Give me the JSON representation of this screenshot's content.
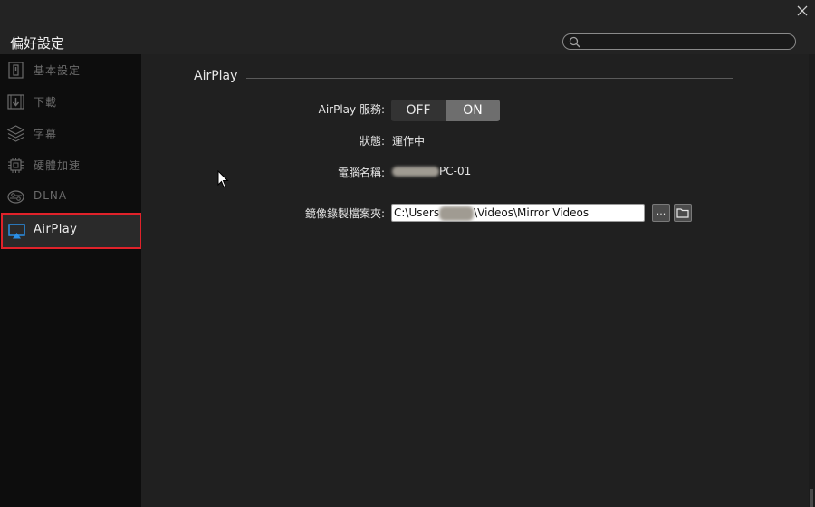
{
  "window": {
    "title": "偏好設定",
    "search_placeholder": ""
  },
  "sidebar": {
    "items": [
      {
        "label": "基本設定",
        "icon": "settings-panel-icon"
      },
      {
        "label": "下載",
        "icon": "download-icon"
      },
      {
        "label": "字幕",
        "icon": "layers-icon"
      },
      {
        "label": "硬體加速",
        "icon": "chip-icon"
      },
      {
        "label": "DLNA",
        "icon": "dlna-icon"
      },
      {
        "label": "AirPlay",
        "icon": "airplay-icon",
        "active": true
      }
    ]
  },
  "main": {
    "section_title": "AirPlay",
    "service": {
      "label": "AirPlay 服務:",
      "off_label": "OFF",
      "on_label": "ON",
      "selected": "ON"
    },
    "status": {
      "label": "狀態:",
      "value": "運作中"
    },
    "computer_name": {
      "label": "電腦名稱:",
      "value_suffix": "PC-01"
    },
    "mirror_folder": {
      "label": "鏡像錄製檔案夾:",
      "path_prefix": "C:\\Users",
      "path_suffix": "\\Videos\\Mirror Videos",
      "browse_label": "..."
    }
  },
  "colors": {
    "accent_border": "#e0222a",
    "toggle_on": "#6e6e6e",
    "toggle_off": "#333333",
    "sidebar_bg": "#0d0d0d"
  }
}
